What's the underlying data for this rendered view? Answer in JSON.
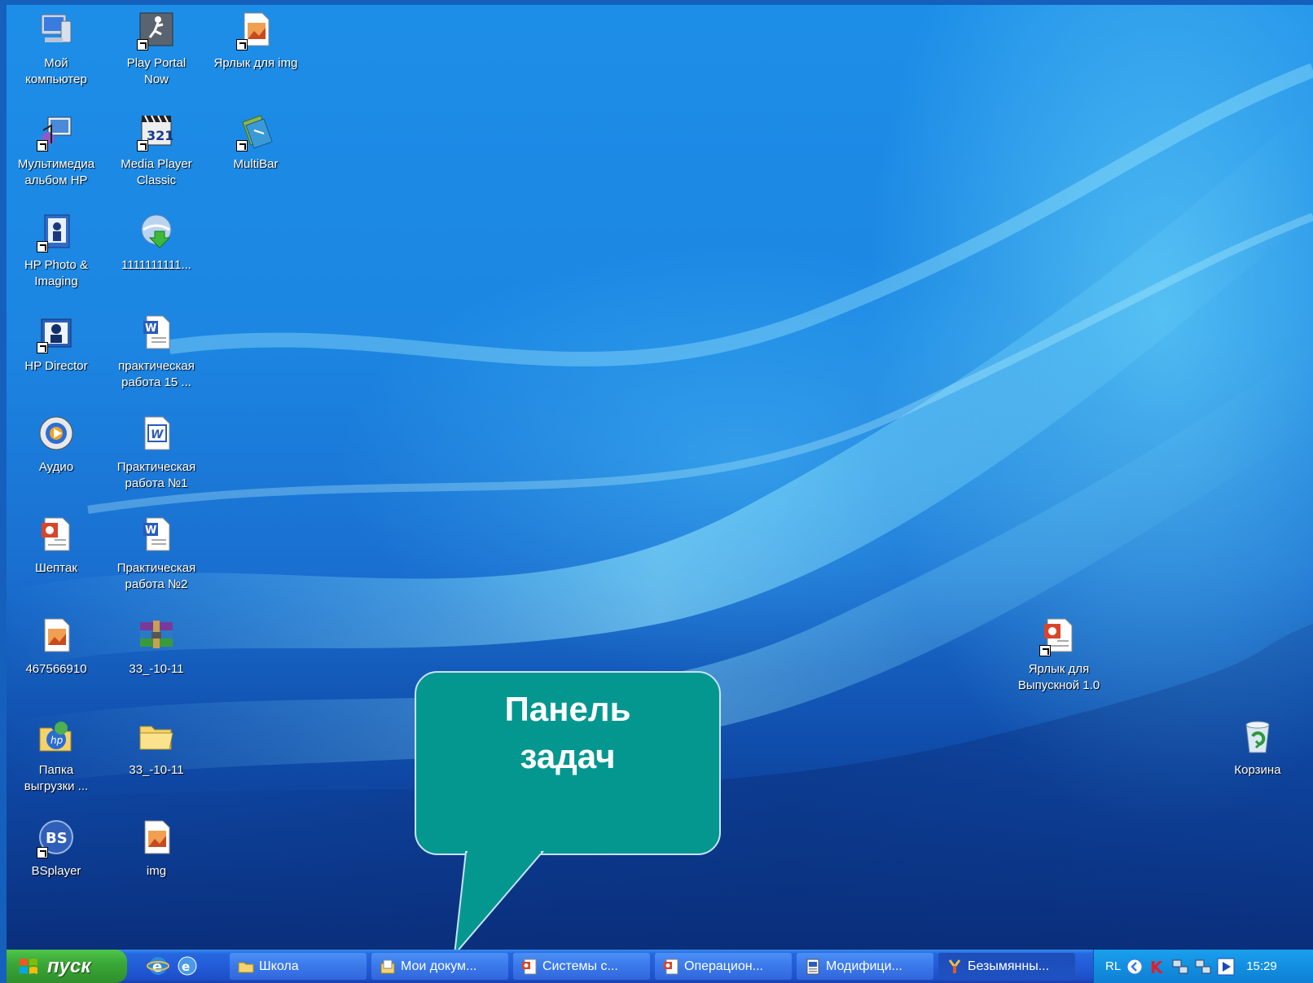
{
  "desktop": {
    "icons": [
      {
        "label": "Мой\nкомпьютер",
        "icon": "my-computer-icon"
      },
      {
        "label": "Play Portal\nNow",
        "icon": "play-portal-icon"
      },
      {
        "label": "Ярлык для img",
        "icon": "image-shortcut-icon"
      },
      {
        "label": "Мультимедиа\nальбом HP",
        "icon": "multimedia-album-icon"
      },
      {
        "label": "Media Player\nClassic",
        "icon": "media-player-icon"
      },
      {
        "label": "MultiBar",
        "icon": "multibar-icon"
      },
      {
        "label": "HP Photo &\nImaging",
        "icon": "hp-photo-icon"
      },
      {
        "label": "1111111111...",
        "icon": "download-icon"
      },
      {
        "label": "HP Director",
        "icon": "hp-director-icon"
      },
      {
        "label": "практическая\nработа 15 ...",
        "icon": "word-document-icon"
      },
      {
        "label": "Аудио",
        "icon": "audio-icon"
      },
      {
        "label": "Практическая\nработа №1",
        "icon": "word-document-icon"
      },
      {
        "label": "Шептак",
        "icon": "powerpoint-icon"
      },
      {
        "label": "Практическая\nработа №2",
        "icon": "word-document-icon"
      },
      {
        "label": "467566910",
        "icon": "image-file-icon"
      },
      {
        "label": "33_-10-11",
        "icon": "winrar-archive-icon"
      },
      {
        "label": "Папка\nвыгрузки ...",
        "icon": "hp-folder-icon"
      },
      {
        "label": "33_-10-11",
        "icon": "folder-icon"
      },
      {
        "label": "BSplayer",
        "icon": "bsplayer-icon"
      },
      {
        "label": "img",
        "icon": "image-file-icon"
      },
      {
        "label": "Ярлык для\nВыпускной 1.0",
        "icon": "powerpoint-shortcut-icon"
      },
      {
        "label": "Корзина",
        "icon": "recycle-bin-icon"
      }
    ]
  },
  "callout": {
    "line1": "Панель",
    "line2": "задач"
  },
  "taskbar": {
    "start_label": "пуск",
    "buttons": [
      {
        "label": "Школа",
        "icon": "folder-icon"
      },
      {
        "label": "Мои докум...",
        "icon": "documents-icon"
      },
      {
        "label": "Системы с...",
        "icon": "powerpoint-icon"
      },
      {
        "label": "Операцион...",
        "icon": "powerpoint-icon"
      },
      {
        "label": "Модифици...",
        "icon": "document-icon"
      },
      {
        "label": "Безымянны...",
        "icon": "paint-icon"
      }
    ],
    "tray": {
      "language": "RL",
      "time": "15:29"
    }
  },
  "colors": {
    "callout_fill": "#04978f",
    "taskbar": "#245bd8",
    "start_button": "#3aa837"
  }
}
